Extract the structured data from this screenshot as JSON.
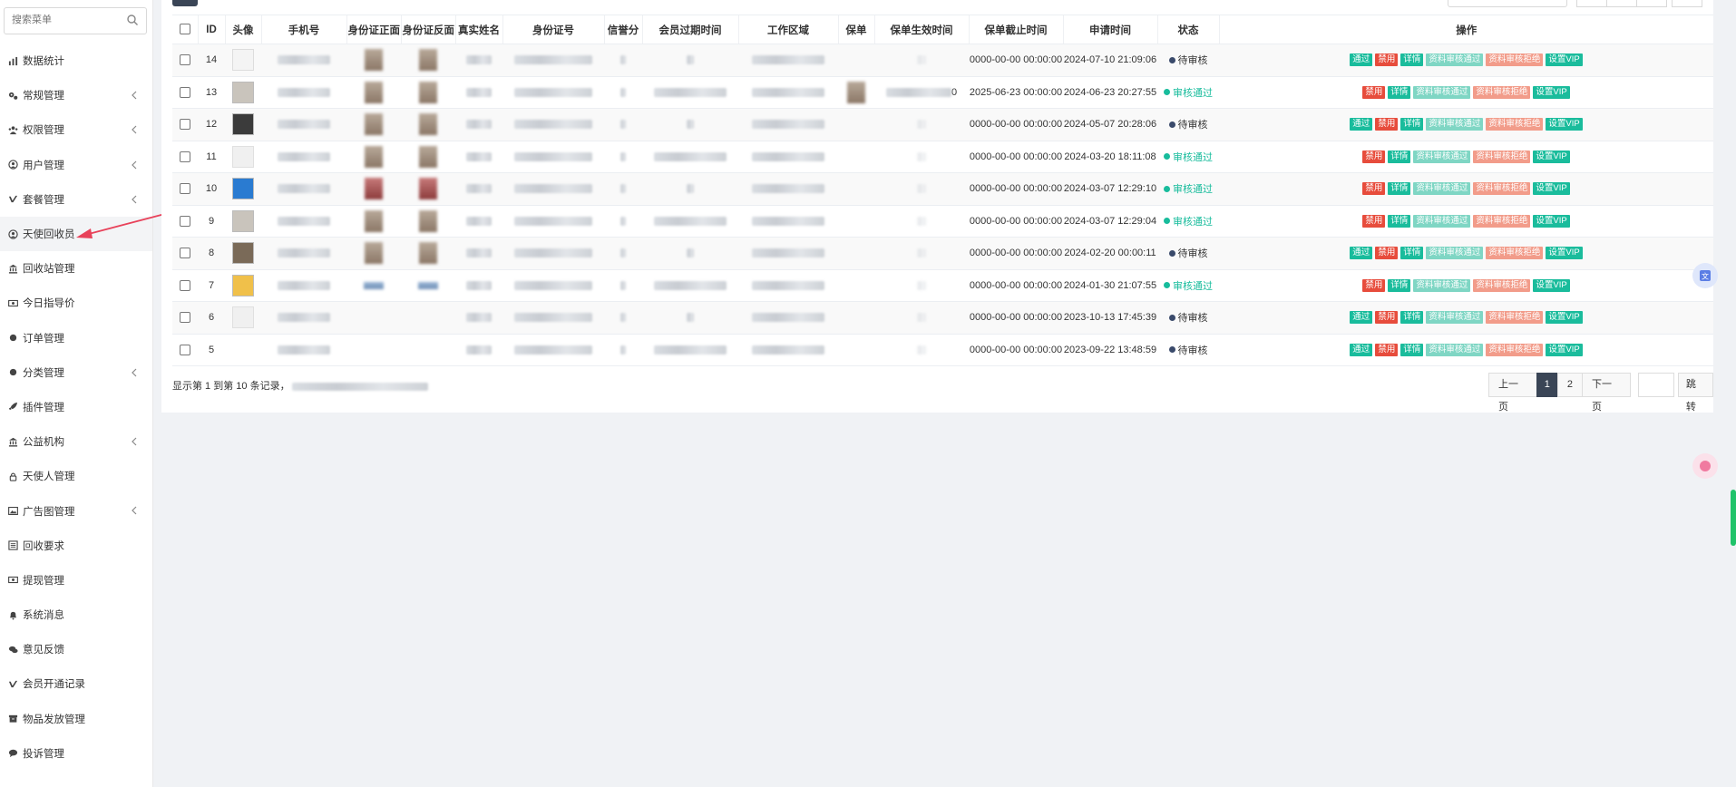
{
  "sidebar": {
    "search_placeholder": "搜索菜单",
    "items": [
      {
        "label": "数据统计",
        "icon": "bar-chart-icon",
        "chevron": false
      },
      {
        "label": "常规管理",
        "icon": "gears-icon",
        "chevron": true
      },
      {
        "label": "权限管理",
        "icon": "users-icon",
        "chevron": true
      },
      {
        "label": "用户管理",
        "icon": "user-circle-icon",
        "chevron": true
      },
      {
        "label": "套餐管理",
        "icon": "vimeo-icon",
        "chevron": true
      },
      {
        "label": "天使回收员",
        "icon": "user-circle-icon",
        "chevron": false,
        "active": true
      },
      {
        "label": "回收站管理",
        "icon": "bank-icon",
        "chevron": false
      },
      {
        "label": "今日指导价",
        "icon": "money-icon",
        "chevron": false
      },
      {
        "label": "订单管理",
        "icon": "circle-icon",
        "chevron": false
      },
      {
        "label": "分类管理",
        "icon": "circle-icon",
        "chevron": true
      },
      {
        "label": "插件管理",
        "icon": "rocket-icon",
        "chevron": false
      },
      {
        "label": "公益机构",
        "icon": "bank-icon",
        "chevron": true
      },
      {
        "label": "天使人管理",
        "icon": "lock-icon",
        "chevron": false
      },
      {
        "label": "广告图管理",
        "icon": "image-icon",
        "chevron": true
      },
      {
        "label": "回收要求",
        "icon": "list-icon",
        "chevron": false
      },
      {
        "label": "提现管理",
        "icon": "money-icon",
        "chevron": false
      },
      {
        "label": "系统消息",
        "icon": "bell-icon",
        "chevron": false
      },
      {
        "label": "意见反馈",
        "icon": "comments-icon",
        "chevron": false
      },
      {
        "label": "会员开通记录",
        "icon": "vimeo-icon",
        "chevron": false
      },
      {
        "label": "物品发放管理",
        "icon": "archive-icon",
        "chevron": false
      },
      {
        "label": "投诉管理",
        "icon": "comment-icon",
        "chevron": false
      }
    ]
  },
  "table": {
    "columns": [
      "",
      "ID",
      "头像",
      "手机号",
      "身份证正面",
      "身份证反面",
      "真实姓名",
      "身份证号",
      "信誉分",
      "会员过期时间",
      "工作区域",
      "保单",
      "保单生效时间",
      "保单截止时间",
      "申请时间",
      "状态",
      "操作"
    ],
    "rows": [
      {
        "id": "14",
        "avatar": "light",
        "idf": "normal",
        "idb": "normal",
        "policy_end": "0000-00-00 00:00:00",
        "apply_time": "2024-07-10 21:09:06",
        "status": "待审核",
        "status_type": "pending",
        "ops": [
          "通过",
          "禁用",
          "详情",
          "资料审核通过",
          "资料审核拒绝",
          "设置VIP"
        ]
      },
      {
        "id": "13",
        "avatar": "face",
        "idf": "normal",
        "idb": "normal",
        "policy_end": "2025-06-23 00:00:00",
        "apply_time": "2024-06-23 20:27:55",
        "status": "审核通过",
        "status_type": "ok",
        "ops": [
          "禁用",
          "详情",
          "资料审核通过",
          "资料审核拒绝",
          "设置VIP"
        ]
      },
      {
        "id": "12",
        "avatar": "dark",
        "idf": "normal",
        "idb": "normal",
        "policy_end": "0000-00-00 00:00:00",
        "apply_time": "2024-05-07 20:28:06",
        "status": "待审核",
        "status_type": "pending",
        "ops": [
          "通过",
          "禁用",
          "详情",
          "资料审核通过",
          "资料审核拒绝",
          "设置VIP"
        ]
      },
      {
        "id": "11",
        "avatar": "ghost",
        "idf": "normal",
        "idb": "normal",
        "policy_end": "0000-00-00 00:00:00",
        "apply_time": "2024-03-20 18:11:08",
        "status": "审核通过",
        "status_type": "ok",
        "ops": [
          "禁用",
          "详情",
          "资料审核通过",
          "资料审核拒绝",
          "设置VIP"
        ]
      },
      {
        "id": "10",
        "avatar": "blue",
        "idf": "red",
        "idb": "red",
        "policy_end": "0000-00-00 00:00:00",
        "apply_time": "2024-03-07 12:29:10",
        "status": "审核通过",
        "status_type": "ok",
        "ops": [
          "禁用",
          "详情",
          "资料审核通过",
          "资料审核拒绝",
          "设置VIP"
        ]
      },
      {
        "id": "9",
        "avatar": "face",
        "idf": "normal",
        "idb": "normal",
        "policy_end": "0000-00-00 00:00:00",
        "apply_time": "2024-03-07 12:29:04",
        "status": "审核通过",
        "status_type": "ok",
        "ops": [
          "禁用",
          "详情",
          "资料审核通过",
          "资料审核拒绝",
          "设置VIP"
        ]
      },
      {
        "id": "8",
        "avatar": "flag",
        "idf": "normal",
        "idb": "normal",
        "policy_end": "0000-00-00 00:00:00",
        "apply_time": "2024-02-20 00:00:11",
        "status": "待审核",
        "status_type": "pending",
        "ops": [
          "通过",
          "禁用",
          "详情",
          "资料审核通过",
          "资料审核拒绝",
          "设置VIP"
        ]
      },
      {
        "id": "7",
        "avatar": "yellow",
        "idf": "blue",
        "idb": "blue",
        "policy_end": "0000-00-00 00:00:00",
        "apply_time": "2024-01-30 21:07:55",
        "status": "审核通过",
        "status_type": "ok",
        "ops": [
          "禁用",
          "详情",
          "资料审核通过",
          "资料审核拒绝",
          "设置VIP"
        ]
      },
      {
        "id": "6",
        "avatar": "ghost",
        "idf": "none",
        "idb": "none",
        "policy_end": "0000-00-00 00:00:00",
        "apply_time": "2023-10-13 17:45:39",
        "status": "待审核",
        "status_type": "pending",
        "ops": [
          "通过",
          "禁用",
          "详情",
          "资料审核通过",
          "资料审核拒绝",
          "设置VIP"
        ]
      },
      {
        "id": "5",
        "avatar": "none",
        "idf": "none",
        "idb": "none",
        "policy_end": "0000-00-00 00:00:00",
        "apply_time": "2023-09-22 13:48:59",
        "status": "待审核",
        "status_type": "pending",
        "ops": [
          "通过",
          "禁用",
          "详情",
          "资料审核通过",
          "资料审核拒绝",
          "设置VIP"
        ]
      }
    ],
    "row13_policy_start_suffix": "0"
  },
  "pager": {
    "info": "显示第 1 到第 10 条记录，",
    "prev": "上一页",
    "pages": [
      "1",
      "2"
    ],
    "active_page": "1",
    "next": "下一页",
    "go": "跳转"
  },
  "colors": {
    "accent": "#18bc9c",
    "danger": "#e74c3c",
    "dark": "#3a4556",
    "arrow": "#e8425a"
  }
}
